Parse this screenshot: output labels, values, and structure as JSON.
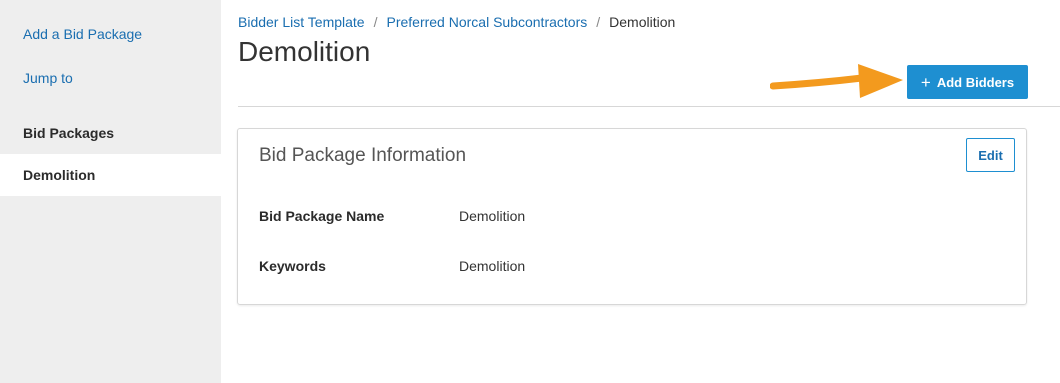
{
  "sidebar": {
    "links": [
      "Add a Bid Package",
      "Jump to"
    ],
    "items": [
      "Bid Packages",
      "Demolition"
    ]
  },
  "breadcrumb": {
    "items": [
      "Bidder List Template",
      "Preferred Norcal Subcontractors"
    ],
    "current": "Demolition",
    "separator": "/"
  },
  "page": {
    "title": "Demolition"
  },
  "toolbar": {
    "add_bidders_label": "Add Bidders",
    "add_icon": "plus-icon"
  },
  "card": {
    "title": "Bid Package Information",
    "edit_label": "Edit",
    "fields": [
      {
        "label": "Bid Package Name",
        "value": "Demolition"
      },
      {
        "label": "Keywords",
        "value": "Demolition"
      }
    ]
  },
  "colors": {
    "accent": "#1e8fd1",
    "link": "#1a6eb0",
    "annotation_arrow": "#f39a1e",
    "sidebar_bg": "#eeeeee"
  }
}
